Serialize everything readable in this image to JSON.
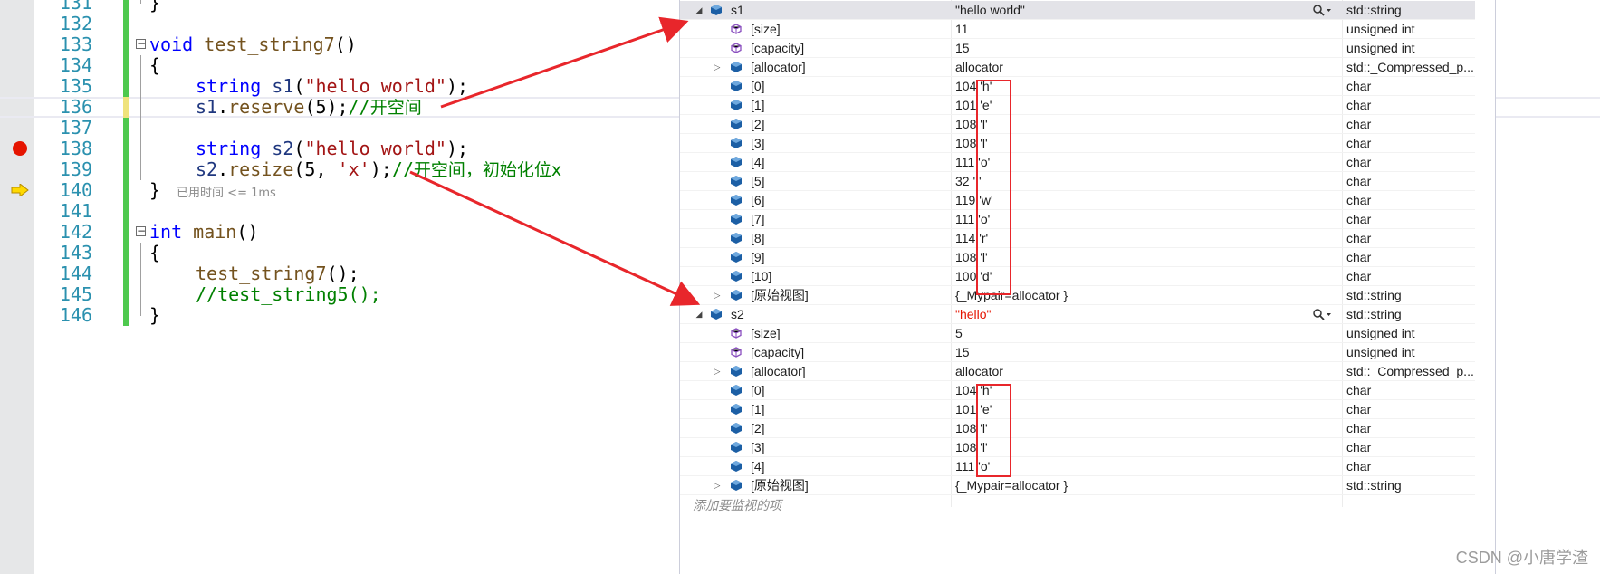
{
  "editor": {
    "lines": [
      {
        "num": "131",
        "code": "}"
      },
      {
        "num": "132",
        "code": ""
      },
      {
        "num": "133",
        "code": "void test_string7()"
      },
      {
        "num": "134",
        "code": "{"
      },
      {
        "num": "135",
        "code": "string s1(\"hello world\");"
      },
      {
        "num": "136",
        "code": "s1.reserve(5);//开空间"
      },
      {
        "num": "137",
        "code": ""
      },
      {
        "num": "138",
        "code": "string s2(\"hello world\");"
      },
      {
        "num": "139",
        "code": "s2.resize(5, 'x');//开空间，初始化位x"
      },
      {
        "num": "140",
        "code": "}"
      },
      {
        "num": "141",
        "code": ""
      },
      {
        "num": "142",
        "code": "int main()"
      },
      {
        "num": "143",
        "code": "{"
      },
      {
        "num": "144",
        "code": "test_string7();"
      },
      {
        "num": "145",
        "code": "//test_string5();"
      },
      {
        "num": "146",
        "code": "}"
      }
    ],
    "elapsed_hint": "已用时间 <= 1ms",
    "colors": {
      "keyword": "#0000ff",
      "function": "#74531f",
      "string": "#a31515",
      "comment": "#008000",
      "line_number": "#2b91af",
      "breakpoint": "#e51400",
      "change_bar": "#4ec94e"
    }
  },
  "watch": {
    "s1": {
      "name": "s1",
      "value": "\"hello world\"",
      "type": "std::string",
      "children": [
        {
          "name": "[size]",
          "value": "11",
          "type": "unsigned int"
        },
        {
          "name": "[capacity]",
          "value": "15",
          "type": "unsigned int"
        },
        {
          "name": "[allocator]",
          "value": "allocator",
          "type": "std::_Compressed_p..."
        },
        {
          "name": "[0]",
          "value": "104 'h'",
          "type": "char"
        },
        {
          "name": "[1]",
          "value": "101 'e'",
          "type": "char"
        },
        {
          "name": "[2]",
          "value": "108 'l'",
          "type": "char"
        },
        {
          "name": "[3]",
          "value": "108 'l'",
          "type": "char"
        },
        {
          "name": "[4]",
          "value": "111 'o'",
          "type": "char"
        },
        {
          "name": "[5]",
          "value": "32 ' '",
          "type": "char"
        },
        {
          "name": "[6]",
          "value": "119 'w'",
          "type": "char"
        },
        {
          "name": "[7]",
          "value": "111 'o'",
          "type": "char"
        },
        {
          "name": "[8]",
          "value": "114 'r'",
          "type": "char"
        },
        {
          "name": "[9]",
          "value": "108 'l'",
          "type": "char"
        },
        {
          "name": "[10]",
          "value": "100 'd'",
          "type": "char"
        },
        {
          "name": "[原始视图]",
          "value": "{_Mypair=allocator }",
          "type": "std::string"
        }
      ]
    },
    "s2": {
      "name": "s2",
      "value": "\"hello\"",
      "type": "std::string",
      "children": [
        {
          "name": "[size]",
          "value": "5",
          "type": "unsigned int"
        },
        {
          "name": "[capacity]",
          "value": "15",
          "type": "unsigned int"
        },
        {
          "name": "[allocator]",
          "value": "allocator",
          "type": "std::_Compressed_p..."
        },
        {
          "name": "[0]",
          "value": "104 'h'",
          "type": "char"
        },
        {
          "name": "[1]",
          "value": "101 'e'",
          "type": "char"
        },
        {
          "name": "[2]",
          "value": "108 'l'",
          "type": "char"
        },
        {
          "name": "[3]",
          "value": "108 'l'",
          "type": "char"
        },
        {
          "name": "[4]",
          "value": "111 'o'",
          "type": "char"
        },
        {
          "name": "[原始视图]",
          "value": "{_Mypair=allocator }",
          "type": "std::string"
        }
      ]
    },
    "add_new_placeholder": "添加要监视的项"
  },
  "watermark": "CSDN @小唐学渣",
  "icons": {
    "expanded": "triangle-down-icon",
    "collapsed": "triangle-right-icon",
    "member": "cube-icon",
    "property": "wrench-cube-icon",
    "search": "magnifier-icon"
  }
}
